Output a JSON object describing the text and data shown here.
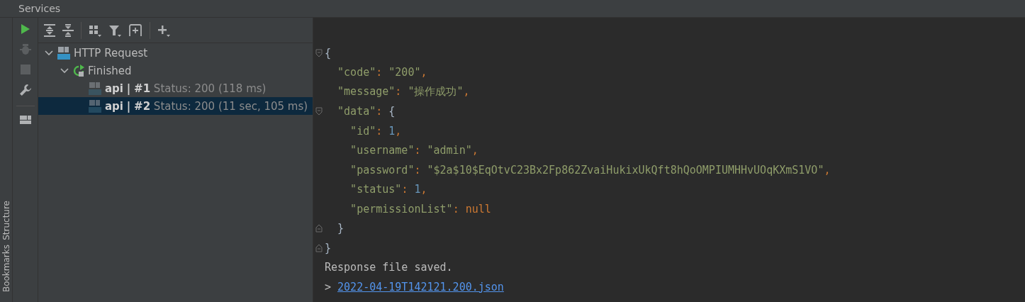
{
  "window": {
    "title": "Services"
  },
  "side_tabs": [
    {
      "label": "Structure"
    },
    {
      "label": "Bookmarks"
    }
  ],
  "left_tools": [
    {
      "kind": "run",
      "disabled": false
    },
    {
      "kind": "debug",
      "disabled": true
    },
    {
      "kind": "stop",
      "disabled": true
    },
    {
      "kind": "wrench",
      "disabled": false
    },
    {
      "kind": "layout",
      "disabled": false
    }
  ],
  "toolbar": [
    {
      "kind": "expand-all"
    },
    {
      "kind": "collapse-all"
    },
    {
      "kind": "sep"
    },
    {
      "kind": "group"
    },
    {
      "kind": "filter"
    },
    {
      "kind": "add-box"
    },
    {
      "kind": "sep"
    },
    {
      "kind": "add"
    }
  ],
  "tree": [
    {
      "kind": "api",
      "label": "HTTP Request",
      "expanded": true,
      "selected": false,
      "children": [
        {
          "kind": "finished",
          "label": "Finished",
          "expanded": true,
          "selected": false,
          "children": [
            {
              "kind": "request",
              "name": "api",
              "separator": "|",
              "number": "#1",
              "status": "Status: 200 (118 ms)",
              "selected": false
            },
            {
              "kind": "request",
              "name": "api",
              "separator": "|",
              "number": "#2",
              "status": "Status: 200 (11 sec, 105 ms)",
              "selected": true
            }
          ]
        }
      ]
    }
  ],
  "editor": {
    "lines": [
      {
        "gutter": {
          "kind": "fold"
        },
        "tokens": [
          {
            "kind": "punct",
            "text": "{"
          }
        ]
      },
      {
        "tokens": [
          {
            "kind": "key",
            "text": "  \"code\""
          },
          {
            "kind": "colon",
            "text": ": "
          },
          {
            "kind": "string",
            "text": "\"200\""
          },
          {
            "kind": "colon",
            "text": ","
          }
        ]
      },
      {
        "tokens": [
          {
            "kind": "key",
            "text": "  \"message\""
          },
          {
            "kind": "colon",
            "text": ": "
          },
          {
            "kind": "string",
            "text": "\"操作成功\""
          },
          {
            "kind": "colon",
            "text": ","
          }
        ]
      },
      {
        "gutter": {
          "kind": "fold"
        },
        "tokens": [
          {
            "kind": "key",
            "text": "  \"data\""
          },
          {
            "kind": "colon",
            "text": ": "
          },
          {
            "kind": "punct",
            "text": "{"
          }
        ]
      },
      {
        "tokens": [
          {
            "kind": "key",
            "text": "    \"id\""
          },
          {
            "kind": "colon",
            "text": ": "
          },
          {
            "kind": "number",
            "text": "1"
          },
          {
            "kind": "colon",
            "text": ","
          }
        ]
      },
      {
        "tokens": [
          {
            "kind": "key",
            "text": "    \"username\""
          },
          {
            "kind": "colon",
            "text": ": "
          },
          {
            "kind": "string",
            "text": "\"admin\""
          },
          {
            "kind": "colon",
            "text": ","
          }
        ]
      },
      {
        "tokens": [
          {
            "kind": "key",
            "text": "    \"password\""
          },
          {
            "kind": "colon",
            "text": ": "
          },
          {
            "kind": "string",
            "text": "\"$2a$10$EqOtvC23Bx2Fp862ZvaiHukixUkQft8hQoOMPIUMHHvUOqKXmS1VO\""
          },
          {
            "kind": "colon",
            "text": ","
          }
        ]
      },
      {
        "tokens": [
          {
            "kind": "key",
            "text": "    \"status\""
          },
          {
            "kind": "colon",
            "text": ": "
          },
          {
            "kind": "number",
            "text": "1"
          },
          {
            "kind": "colon",
            "text": ","
          }
        ]
      },
      {
        "tokens": [
          {
            "kind": "key",
            "text": "    \"permissionList\""
          },
          {
            "kind": "colon",
            "text": ": "
          },
          {
            "kind": "keyword",
            "text": "null"
          }
        ]
      },
      {
        "gutter": {
          "kind": "unfold"
        },
        "tokens": [
          {
            "kind": "punct",
            "text": "  }"
          }
        ]
      },
      {
        "gutter": {
          "kind": "unfold"
        },
        "tokens": [
          {
            "kind": "punct",
            "text": "}"
          }
        ]
      }
    ],
    "console": [
      {
        "kind": "text",
        "text": "Response file saved."
      },
      {
        "kind": "link",
        "prefix": ">",
        "text": "2022-04-19T142121.200.json"
      }
    ]
  }
}
